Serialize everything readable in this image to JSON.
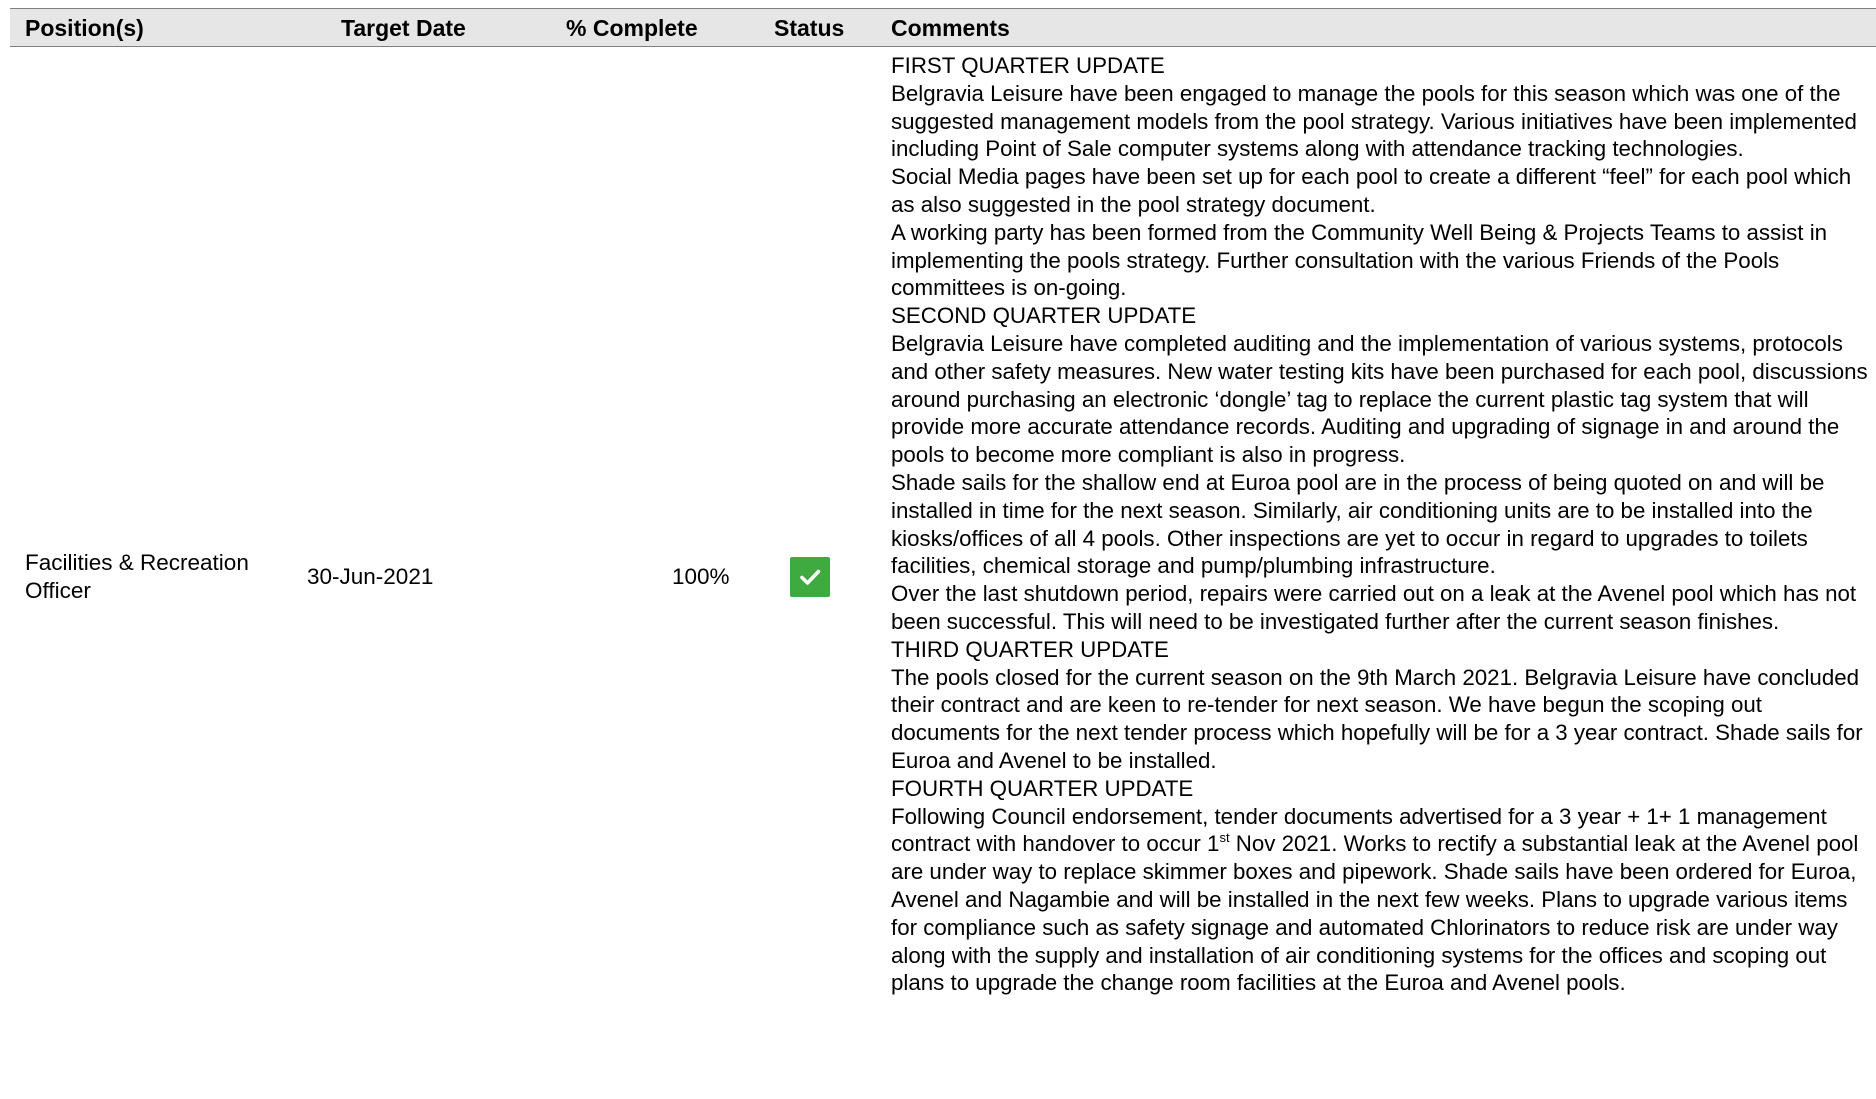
{
  "table": {
    "headers": {
      "position": "Position(s)",
      "target_date": "Target Date",
      "percent_complete": "% Complete",
      "status": "Status",
      "comments": "Comments"
    },
    "row": {
      "position": "Facilities & Recreation Officer",
      "target_date": "30-Jun-2021",
      "percent_complete": "100%",
      "status_icon": "check-icon",
      "status_color": "#3faa3f",
      "comments": {
        "p01": "FIRST QUARTER UPDATE",
        "p02": "Belgravia Leisure have been engaged to manage the pools for this season which was one of the suggested management models from the pool strategy.  Various initiatives have been implemented including Point of Sale computer systems along with attendance tracking technologies.",
        "p03": "Social Media pages have been set up for each pool to create a different “feel” for each pool which as also suggested in the pool strategy document.",
        "p04": "A working party has been formed from the Community Well Being & Projects Teams to assist in implementing the pools strategy.  Further consultation with the various Friends of the Pools committees is on-going.",
        "p05": "SECOND QUARTER UPDATE",
        "p06": "Belgravia Leisure have completed auditing and the implementation of various systems, protocols and other safety measures.  New water testing kits have been purchased for each pool, discussions around purchasing an electronic ‘dongle’ tag to replace the current plastic tag system that will provide more accurate attendance records.  Auditing and upgrading of signage in and around the pools to become more compliant is also in progress.",
        "p07": "Shade sails for the shallow end at Euroa pool are in the process of being quoted on and will be installed in time for the next season.  Similarly, air conditioning units are to be installed into the kiosks/offices of all 4 pools.  Other inspections are yet to occur in regard to upgrades to toilets facilities, chemical storage and pump/plumbing infrastructure.",
        "p08": "Over the last shutdown period, repairs were carried out on a leak at the Avenel pool which has not been successful.  This will need to be investigated further after the current season finishes.",
        "p09": "THIRD QUARTER UPDATE",
        "p10": "The pools closed for the current season on the 9th March 2021. Belgravia Leisure have concluded their contract and are keen to re-tender for next season.  We have begun the scoping out documents for the next tender process which hopefully will be for a 3 year contract.   Shade sails for Euroa and Avenel to be installed.",
        "p11": "FOURTH QUARTER UPDATE",
        "p12a": "Following Council endorsement, tender documents advertised for a 3 year + 1+ 1 management contract with handover to occur 1",
        "p12sup": "st",
        "p12b": " Nov 2021. Works to rectify a substantial leak at the Avenel pool are under way to replace skimmer boxes and pipework.  Shade sails have been ordered for Euroa, Avenel and Nagambie and will be installed in the next few weeks.  Plans to upgrade various items for compliance such as safety signage and automated Chlorinators to reduce risk are under way along with the supply and installation of air conditioning systems for the offices and scoping out plans to upgrade the change room facilities at the Euroa and Avenel pools."
      }
    }
  },
  "colors": {
    "header_bg": "#e7e6e6",
    "header_rule": "#7f7f7f",
    "top_link": "#2e5597"
  }
}
